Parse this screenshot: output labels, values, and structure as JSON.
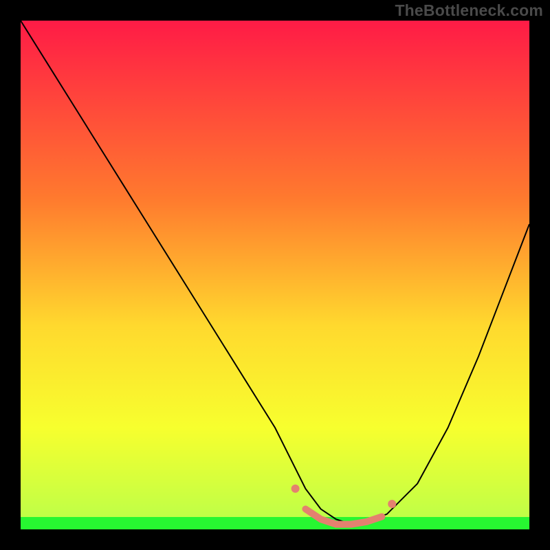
{
  "watermark": "TheBottleneck.com",
  "colors": {
    "black": "#000000",
    "curve": "#000000",
    "salmon": "#e4816f",
    "green": "#27f731",
    "grad_top": "#ff1b46",
    "grad_mid1": "#ff7a2e",
    "grad_mid2": "#ffd92e",
    "grad_mid3": "#f7ff2e",
    "grad_bot": "#b8ff4a"
  },
  "chart_data": {
    "type": "line",
    "title": "",
    "xlabel": "",
    "ylabel": "",
    "xlim": [
      0,
      100
    ],
    "ylim": [
      0,
      100
    ],
    "series": [
      {
        "name": "bottleneck-curve",
        "x": [
          0,
          5,
          10,
          15,
          20,
          25,
          30,
          35,
          40,
          45,
          50,
          53,
          56,
          59,
          62,
          65,
          68,
          72,
          78,
          84,
          90,
          95,
          100
        ],
        "y": [
          100,
          92,
          84,
          76,
          68,
          60,
          52,
          44,
          36,
          28,
          20,
          14,
          8,
          4,
          2,
          1,
          1.5,
          3,
          9,
          20,
          34,
          47,
          60
        ]
      }
    ],
    "flat_band": {
      "name": "highlight-flat",
      "x": [
        56,
        59,
        62,
        65,
        68,
        71
      ],
      "y": [
        4,
        2,
        1,
        1,
        1.5,
        2.5
      ]
    },
    "left_tick": {
      "x": 54,
      "y": 8
    },
    "right_tick": {
      "x": 73,
      "y": 5
    }
  }
}
